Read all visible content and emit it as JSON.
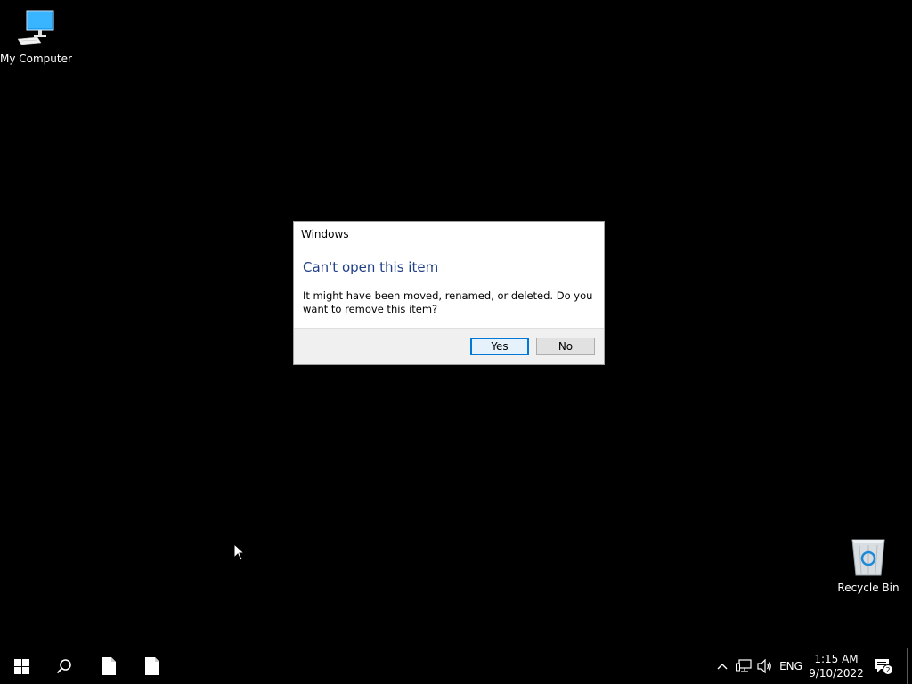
{
  "desktop": {
    "icons": [
      {
        "label": "My Computer",
        "icon": "computer-icon"
      },
      {
        "label": "Recycle Bin",
        "icon": "recycle-bin-icon"
      }
    ]
  },
  "dialog": {
    "title": "Windows",
    "heading": "Can't open this item",
    "message": "It might have been moved, renamed, or deleted. Do you want to remove this item?",
    "yes_label": "Yes",
    "no_label": "No"
  },
  "taskbar": {
    "start_icon": "windows-logo-icon",
    "search_icon": "search-icon",
    "pinned": [
      {
        "icon": "file-icon"
      },
      {
        "icon": "file-icon"
      }
    ],
    "tray": {
      "language": "ENG",
      "time": "1:15 AM",
      "date": "9/10/2022",
      "notification_count": "2"
    }
  },
  "colors": {
    "desktop_bg": "#000000",
    "heading": "#1f3f86",
    "accent": "#0078d7"
  }
}
